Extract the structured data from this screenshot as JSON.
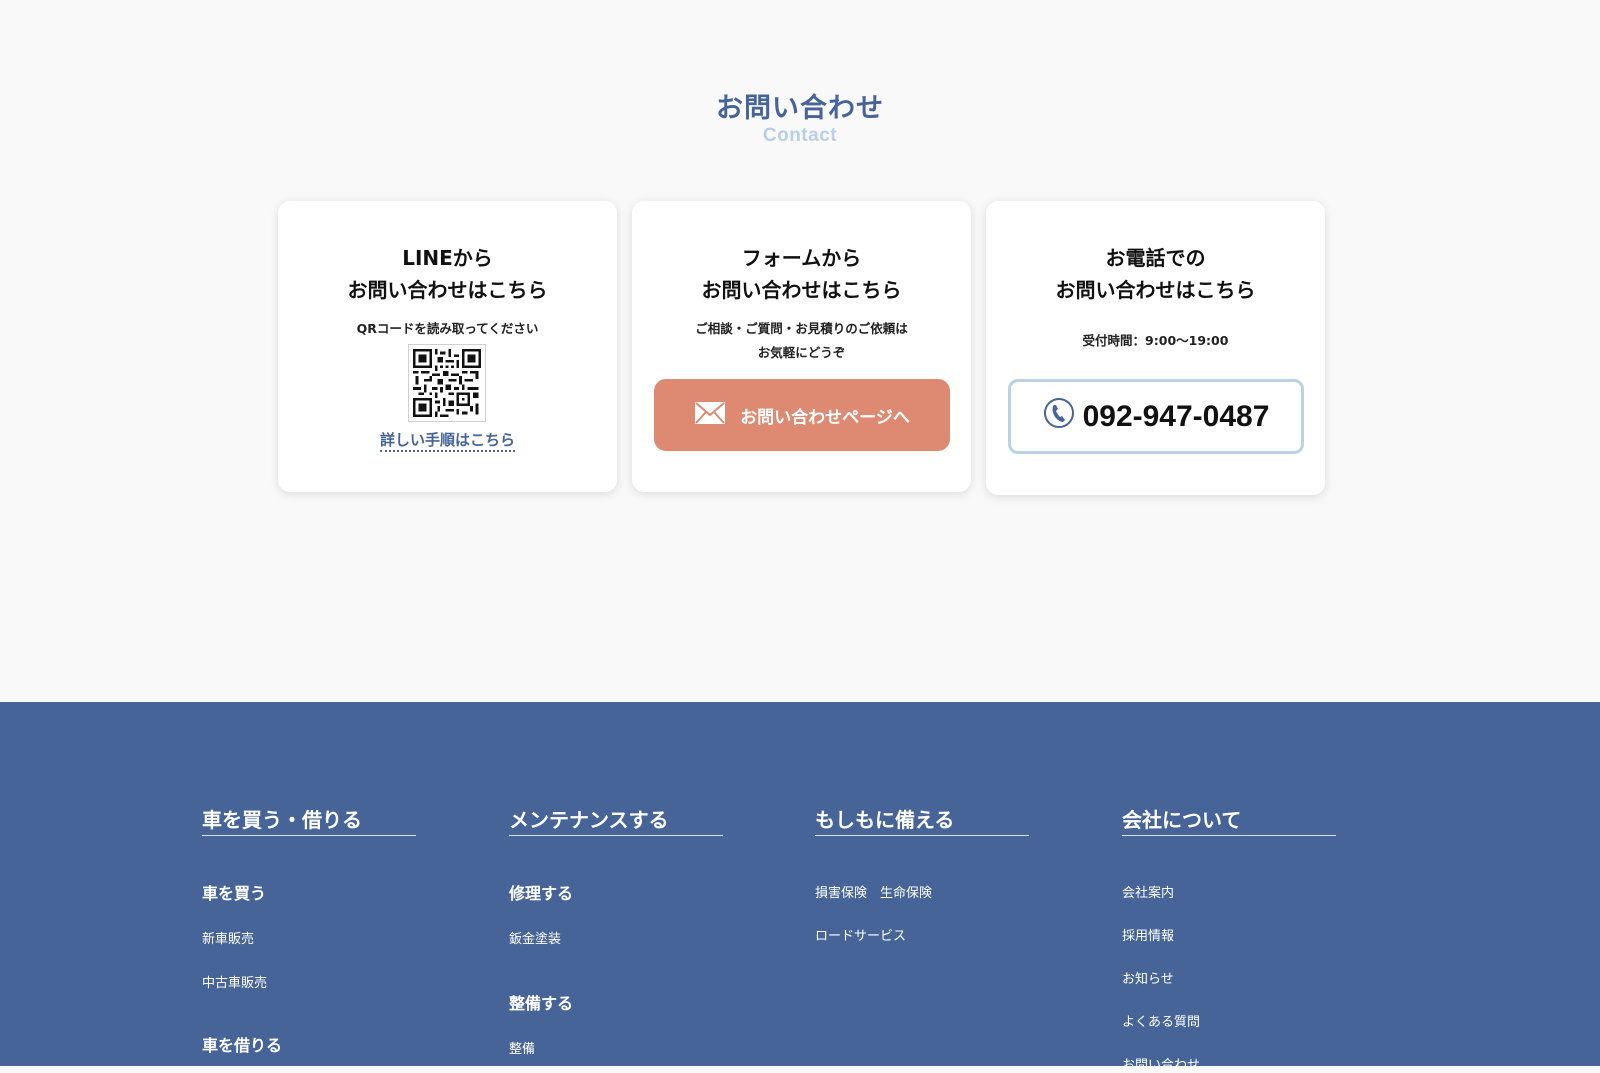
{
  "contact": {
    "title": "お問い合わせ",
    "subtitle": "Contact",
    "line_card": {
      "title_line1": "LINEから",
      "title_line2": "お問い合わせはこちら",
      "note": "QRコードを読み取ってください",
      "link": "詳しい手順はこちら"
    },
    "form_card": {
      "title_line1": "フォームから",
      "title_line2": "お問い合わせはこちら",
      "note_line1": "ご相談・ご質問・お見積りのご依頼は",
      "note_line2": "お気軽にどうぞ",
      "button": "お問い合わせページへ",
      "button_color": "#de8a72"
    },
    "tel_card": {
      "title_line1": "お電話での",
      "title_line2": "お問い合わせはこちら",
      "hours": "受付時間：9:00〜19:00",
      "phone": "092-947-0487"
    }
  },
  "footer": {
    "background": "#476499",
    "col1": {
      "heading": "車を買う・借りる",
      "sub1": "車を買う",
      "link1": "新車販売",
      "link2": "中古車販売",
      "sub2": "車を借りる"
    },
    "col2": {
      "heading": "メンテナンスする",
      "sub1": "修理する",
      "link1": "鈑金塗装",
      "sub2": "整備する",
      "link2": "整備"
    },
    "col3": {
      "heading": "もしもに備える",
      "link1": "損害保険　生命保険",
      "link2": "ロードサービス"
    },
    "col4": {
      "heading": "会社について",
      "link1": "会社案内",
      "link2": "採用情報",
      "link3": "お知らせ",
      "link4": "よくある質問",
      "link5": "お問い合わせ"
    }
  },
  "icons": {
    "mail": "mail-icon",
    "phone": "phone-icon",
    "qr": "qr-code"
  }
}
